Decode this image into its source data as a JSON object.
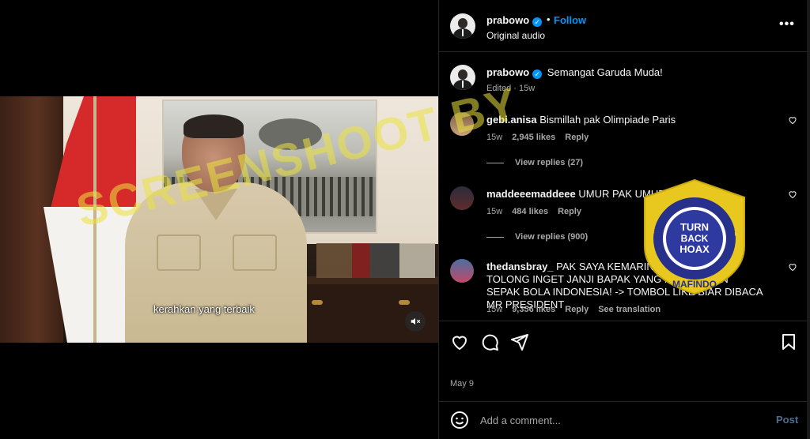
{
  "video": {
    "caption_text": "kerahkan yang terbaik",
    "watermark_text": "SCREENSHOOT BY",
    "mute_icon": "speaker-muted-icon"
  },
  "post": {
    "username": "prabowo",
    "verified": true,
    "follow_label": "Follow",
    "audio_label": "Original audio",
    "more_icon": "more-horizontal-icon",
    "caption": {
      "username": "prabowo",
      "text": "Semangat Garuda Muda!",
      "meta": "Edited · 15w"
    },
    "comments": [
      {
        "username": "gebi.anisa",
        "text": "Bismillah pak Olimpiade Paris",
        "age": "15w",
        "likes": "2,945 likes",
        "reply_label": "Reply",
        "view_replies": "View replies (27)"
      },
      {
        "username": "maddeeemaddeee",
        "text": "UMUR PAK UMUR!!!!",
        "age": "15w",
        "likes": "484 likes",
        "reply_label": "Reply",
        "view_replies": "View replies (900)"
      },
      {
        "username": "thedansbray_",
        "text": "PAK SAYA KEMARIN MILIH BAPAK! TOLONG INGET JANJI BAPAK YANG MAU MAJUIN SEPAK BOLA INDONESIA! -> TOMBOL LIKE BIAR DIBACA MR PRESIDENT",
        "age": "15w",
        "likes": "9,356 likes",
        "reply_label": "Reply",
        "translation_label": "See translation"
      }
    ],
    "date": "May 9",
    "comment_placeholder": "Add a comment...",
    "post_label": "Post"
  },
  "badge": {
    "outer_text": "MASYARAKAT ANTI FITNAH INDONESIA",
    "inner_line1": "TURN",
    "inner_line2": "BACK",
    "inner_line3": "HOAX",
    "bottom_text": "MAFINDO"
  },
  "colors": {
    "accent": "#0095f6",
    "watermark": "#ebe23c",
    "badge_gold": "#e8c81e",
    "badge_blue": "#27308a"
  }
}
